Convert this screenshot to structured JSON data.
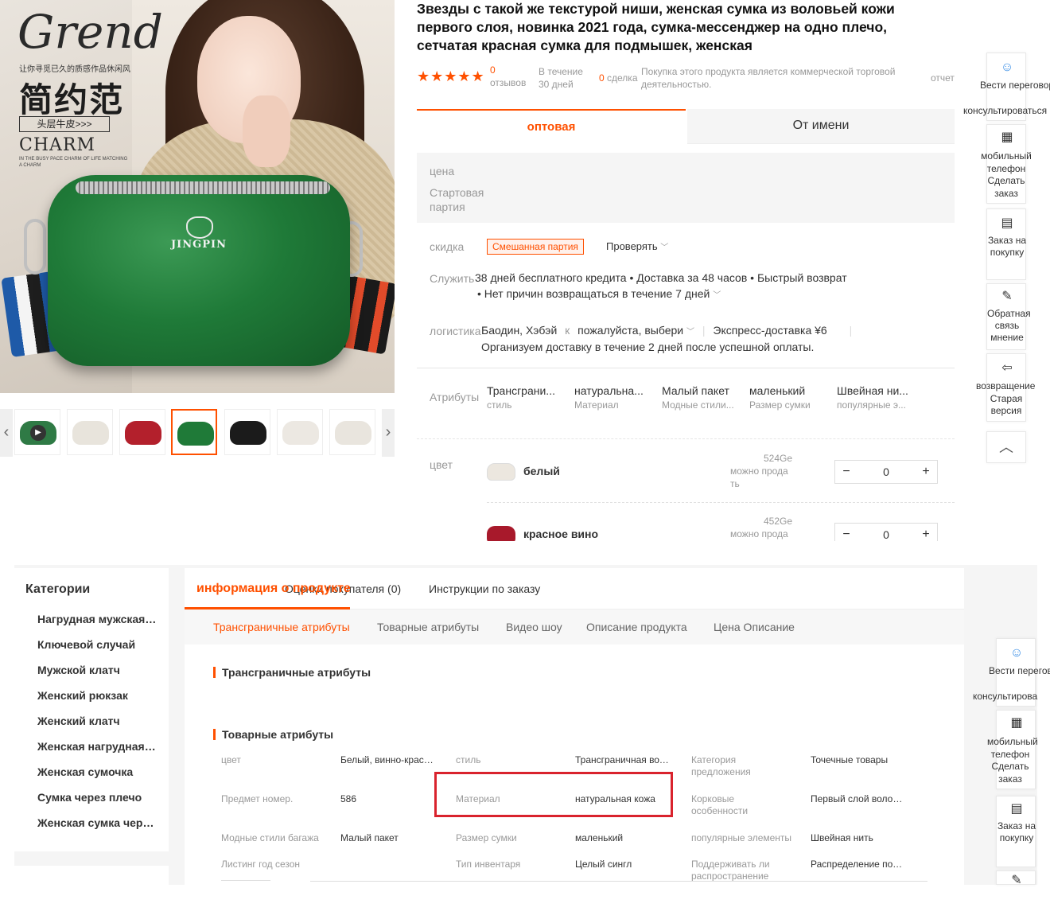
{
  "gallery": {
    "brand": {
      "script": "Grend",
      "subtitle": "让你寻觅已久的质感作品休闲风",
      "cn_title": "简约范",
      "box_label": "头层牛皮>>>",
      "charm": "CHARM",
      "tagline": "IN THE BUSY PACE CHARM OF LIFE MATCHING A CHARM"
    },
    "bag_logo": "JINGPIN",
    "thumb_prev": "‹",
    "thumb_next": "›",
    "thumb_colors": [
      "#2f7a45",
      "#e8e4dc",
      "#b3202c",
      "#1f7a38",
      "#1b1b1b",
      "#ece8e2",
      "#e9e5de"
    ],
    "active_thumb": 3
  },
  "product": {
    "title": "Звезды с такой же текстурой ниши, женская сумка из воловьей кожи первого слоя, новинка 2021 года, сумка-мессенджер на одно плечо, сетчатая красная сумка для подмышек, женская",
    "stars": "★★★★★",
    "reviews_count": "0",
    "reviews_label": "отзывов",
    "period_line1": "В течение",
    "period_line2": "30 дней",
    "deals_count": "0",
    "deals_label": "сделка",
    "notice": "Покупка этого продукта является коммерческой торговой деятельностью.",
    "report": "отчет"
  },
  "buy_tabs": {
    "wholesale": "оптовая",
    "named": "От имени"
  },
  "price": {
    "price_label": "цена",
    "batch_label_1": "Стартовая",
    "batch_label_2": "партия"
  },
  "discount": {
    "label": "скидка",
    "badge": "Смешанная партия",
    "check": "Проверять"
  },
  "service": {
    "label": "Служить",
    "line1": "38 дней бесплатного кредита • Доставка за 48 часов • Быстрый возврат",
    "line2": "• Нет причин возвращаться в течение 7 дней"
  },
  "logistics": {
    "label": "логистика",
    "from": "Баодин, Хэбэй",
    "to_sep": "к",
    "choose": "пожалуйста, выбери",
    "express": "Экспресс-доставка ¥6",
    "note": "Организуем доставку в течение 2 дней после успешной оплаты."
  },
  "attributes": {
    "label": "Атрибуты",
    "items": [
      {
        "value": "Трансграни...",
        "key": "стиль"
      },
      {
        "value": "натуральна...",
        "key": "Материал"
      },
      {
        "value": "Малый пакет",
        "key": "Модные стили..."
      },
      {
        "value": "маленький",
        "key": "Размер сумки"
      },
      {
        "value": "Швейная ни...",
        "key": "популярные э..."
      }
    ]
  },
  "colors": {
    "label": "цвет",
    "skus": [
      {
        "name": "белый",
        "stock": "524Ge",
        "stock_label": "можно прода ть",
        "qty": "0",
        "swatch": "#ece7df"
      },
      {
        "name": "красное вино",
        "stock": "452Ge",
        "stock_label": "можно прода",
        "qty": "0",
        "swatch": "#a8192b"
      }
    ],
    "minus": "−",
    "plus": "+"
  },
  "float_top": {
    "negotiate": "Вести переговоры",
    "consult": "консультироваться",
    "mobile": "мобильный телефон Сделать заказ",
    "order": "Заказ на покупку",
    "feedback": "Обратная связь мнение",
    "oldversion_1": "возвращение",
    "oldversion_2": "Старая версия",
    "up": "︿"
  },
  "float_bottom": {
    "negotiate": "Вести переговоры",
    "consult": "консультирова",
    "mobile": "мобильный телефон Сделать заказ",
    "order": "Заказ на покупку"
  },
  "categories": {
    "title": "Категории",
    "items": [
      "Нагрудная мужская сумка",
      "Ключевой случай",
      "Мужской клатч",
      "Женский рюкзак",
      "Женский клатч",
      "Женская нагрудная сумка",
      "Женская сумочка",
      "Сумка через плечо",
      "Женская сумка через плечо"
    ]
  },
  "info": {
    "tab_info": "информация о продукте",
    "tab_reviews": "Оценки покупателя (0)",
    "tab_instructions": "Инструкции по заказу",
    "sub_tabs": [
      "Трансграничные атрибуты",
      "Товарные атрибуты",
      "Видео шоу",
      "Описание продукта",
      "Цена Описание"
    ],
    "section_cross": "Трансграничные атрибуты",
    "section_goods": "Товарные атрибуты",
    "rows": [
      {
        "k1": "цвет",
        "v1": "Белый, винно-красный",
        "k2": "стиль",
        "v2": "Трансграничная волна",
        "k3": "Категория предложения",
        "v3": "Точечные товары"
      },
      {
        "k1": "Предмет номер.",
        "v1": "586",
        "k2": "Материал",
        "v2": "натуральная кожа",
        "k3": "Корковые особенности",
        "v3": "Первый слой воловьей кожи"
      },
      {
        "k1": "Модные стили багажа",
        "v1": "Малый пакет",
        "k2": "Размер сумки",
        "v2": "маленький",
        "k3": "популярные элементы",
        "v3": "Швейная нить"
      },
      {
        "k1": "Листинг год сезон",
        "v1": "",
        "k2": "Тип инвентаря",
        "v2": "Целый сингл",
        "k3": "Поддерживать ли распространение",
        "v3": "Распределение поддержки"
      }
    ]
  },
  "accent_color": "#ff5000",
  "highlight_color": "#d9232d"
}
